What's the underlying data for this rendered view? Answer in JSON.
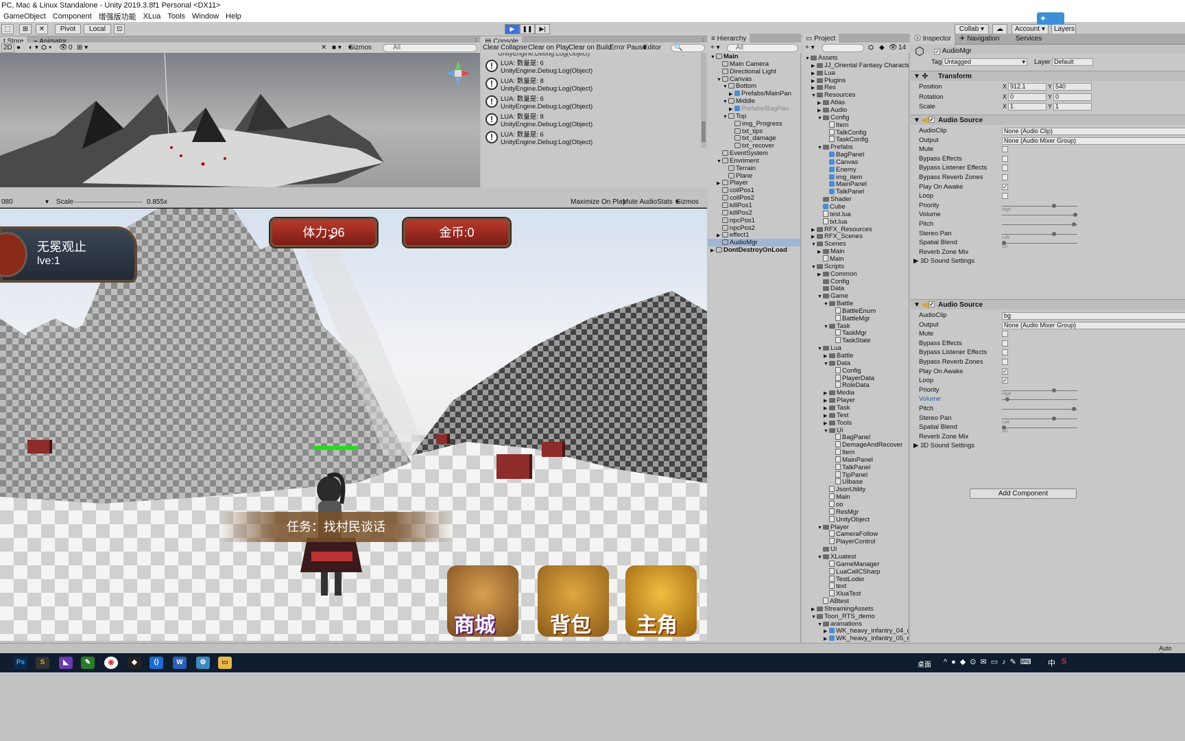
{
  "window": {
    "title": "PC, Mac & Linux Standalone - Unity 2019.3.8f1 Personal <DX11>"
  },
  "menu": [
    "GameObject",
    "Component",
    "增强版功能",
    "XLua",
    "Tools",
    "Window",
    "Help"
  ],
  "toolbar": {
    "pivot": "Pivot",
    "local": "Local",
    "collab": "Collab",
    "account": "Account",
    "layers": "Layers"
  },
  "scene": {
    "tabs": [
      "t Store",
      "Animator"
    ],
    "mode": "2D",
    "layer_count": "0",
    "gizmos": "Gizmos",
    "search": "All"
  },
  "console": {
    "tab": "Console",
    "buttons": [
      "Clear",
      "Collapse",
      "Clear on Play",
      "Clear on Build",
      "Error Pause",
      "Editor"
    ],
    "entries": [
      {
        "line1": "LUA: 数量是:  6",
        "line2": "UnityEngine.Debug:Log(Object)"
      },
      {
        "line1": "LUA: 数量是:  8",
        "line2": "UnityEngine.Debug:Log(Object)"
      },
      {
        "line1": "LUA: 数量是:  6",
        "line2": "UnityEngine.Debug:Log(Object)"
      },
      {
        "line1": "LUA: 数量是:  8",
        "line2": "UnityEngine.Debug:Log(Object)"
      },
      {
        "line1": "LUA: 数量是:  6",
        "line2": "UnityEngine.Debug:Log(Object)"
      }
    ]
  },
  "game": {
    "resolution": "080",
    "scale_label": "Scale",
    "scale_value": "0.855x",
    "buttons": [
      "Maximize On Play",
      "Mute Audio",
      "Stats",
      "Gizmos"
    ],
    "hud": {
      "player_name": "无冕观止",
      "level": "lve:1",
      "stamina": "体力:96",
      "gold": "金币:0",
      "task": "任务：找村民谈话",
      "shop": "商城",
      "bag": "背包",
      "hero": "主角"
    }
  },
  "hierarchy": {
    "tab": "Hierarchy",
    "search": "All",
    "items": [
      {
        "label": "Main",
        "depth": 0,
        "arrow": "▼",
        "type": "scene"
      },
      {
        "label": "Main Camera",
        "depth": 1,
        "arrow": "",
        "type": "go"
      },
      {
        "label": "Directional Light",
        "depth": 1,
        "arrow": "",
        "type": "go"
      },
      {
        "label": "Canvas",
        "depth": 1,
        "arrow": "▼",
        "type": "go"
      },
      {
        "label": "Bottom",
        "depth": 2,
        "arrow": "▼",
        "type": "go"
      },
      {
        "label": "Prefabs/MainPan",
        "depth": 3,
        "arrow": "▶",
        "type": "pref"
      },
      {
        "label": "Middle",
        "depth": 2,
        "arrow": "▼",
        "type": "go"
      },
      {
        "label": "Prefabs/BagPan",
        "depth": 3,
        "arrow": "▶",
        "type": "pref"
      },
      {
        "label": "Top",
        "depth": 2,
        "arrow": "▼",
        "type": "go"
      },
      {
        "label": "img_Progress",
        "depth": 3,
        "arrow": "",
        "type": "go"
      },
      {
        "label": "txt_tips",
        "depth": 3,
        "arrow": "",
        "type": "go"
      },
      {
        "label": "txt_damage",
        "depth": 3,
        "arrow": "",
        "type": "go"
      },
      {
        "label": "txt_recover",
        "depth": 3,
        "arrow": "",
        "type": "go"
      },
      {
        "label": "EventSystem",
        "depth": 1,
        "arrow": "",
        "type": "go"
      },
      {
        "label": "Envriment",
        "depth": 1,
        "arrow": "▼",
        "type": "go"
      },
      {
        "label": "Terrain",
        "depth": 2,
        "arrow": "",
        "type": "go"
      },
      {
        "label": "Plane",
        "depth": 2,
        "arrow": "",
        "type": "go"
      },
      {
        "label": "Player",
        "depth": 1,
        "arrow": "▶",
        "type": "go"
      },
      {
        "label": "collPos1",
        "depth": 1,
        "arrow": "",
        "type": "go"
      },
      {
        "label": "collPos2",
        "depth": 1,
        "arrow": "",
        "type": "go"
      },
      {
        "label": "killPos1",
        "depth": 1,
        "arrow": "",
        "type": "go"
      },
      {
        "label": "killPos2",
        "depth": 1,
        "arrow": "",
        "type": "go"
      },
      {
        "label": "npcPos1",
        "depth": 1,
        "arrow": "",
        "type": "go"
      },
      {
        "label": "npcPos2",
        "depth": 1,
        "arrow": "",
        "type": "go"
      },
      {
        "label": "effect1",
        "depth": 1,
        "arrow": "▶",
        "type": "go"
      },
      {
        "label": "AudioMgr",
        "depth": 1,
        "arrow": "",
        "type": "go"
      },
      {
        "label": "DontDestroyOnLoad",
        "depth": 0,
        "arrow": "▶",
        "type": "scene"
      }
    ]
  },
  "project": {
    "tab": "Project",
    "count": "14",
    "items": [
      {
        "label": "Assets",
        "depth": 0,
        "arrow": "▼",
        "type": "folder"
      },
      {
        "label": "JJ_Oriental Fantasy Character",
        "depth": 1,
        "arrow": "▶",
        "type": "folder"
      },
      {
        "label": "Lua",
        "depth": 1,
        "arrow": "▶",
        "type": "folder"
      },
      {
        "label": "Plugins",
        "depth": 1,
        "arrow": "▶",
        "type": "folder"
      },
      {
        "label": "Res",
        "depth": 1,
        "arrow": "▶",
        "type": "folder"
      },
      {
        "label": "Resources",
        "depth": 1,
        "arrow": "▼",
        "type": "folder"
      },
      {
        "label": "Atlas",
        "depth": 2,
        "arrow": "▶",
        "type": "folder"
      },
      {
        "label": "Audio",
        "depth": 2,
        "arrow": "▶",
        "type": "folder"
      },
      {
        "label": "Config",
        "depth": 2,
        "arrow": "▼",
        "type": "folder"
      },
      {
        "label": "Item",
        "depth": 3,
        "arrow": "",
        "type": "cs"
      },
      {
        "label": "TalkConfig",
        "depth": 3,
        "arrow": "",
        "type": "cs"
      },
      {
        "label": "TaskConfig",
        "depth": 3,
        "arrow": "",
        "type": "cs"
      },
      {
        "label": "Prefabs",
        "depth": 2,
        "arrow": "▼",
        "type": "folder"
      },
      {
        "label": "BagPanel",
        "depth": 3,
        "arrow": "",
        "type": "pref"
      },
      {
        "label": "Canvas",
        "depth": 3,
        "arrow": "",
        "type": "pref"
      },
      {
        "label": "Enemy",
        "depth": 3,
        "arrow": "",
        "type": "pref"
      },
      {
        "label": "img_item",
        "depth": 3,
        "arrow": "",
        "type": "pref"
      },
      {
        "label": "MainPanel",
        "depth": 3,
        "arrow": "",
        "type": "pref"
      },
      {
        "label": "TalkPanel",
        "depth": 3,
        "arrow": "",
        "type": "pref"
      },
      {
        "label": "Shader",
        "depth": 2,
        "arrow": "",
        "type": "folder"
      },
      {
        "label": "Cube",
        "depth": 2,
        "arrow": "",
        "type": "pref"
      },
      {
        "label": "test.lua",
        "depth": 2,
        "arrow": "",
        "type": "cs"
      },
      {
        "label": "txt.lua",
        "depth": 2,
        "arrow": "",
        "type": "cs"
      },
      {
        "label": "RFX_Resources",
        "depth": 1,
        "arrow": "▶",
        "type": "folder"
      },
      {
        "label": "RFX_Scenes",
        "depth": 1,
        "arrow": "▶",
        "type": "folder"
      },
      {
        "label": "Scenes",
        "depth": 1,
        "arrow": "▼",
        "type": "folder"
      },
      {
        "label": "Main",
        "depth": 2,
        "arrow": "▶",
        "type": "folder"
      },
      {
        "label": "Main",
        "depth": 2,
        "arrow": "",
        "type": "cs"
      },
      {
        "label": "Scripts",
        "depth": 1,
        "arrow": "▼",
        "type": "folder"
      },
      {
        "label": "Common",
        "depth": 2,
        "arrow": "▶",
        "type": "folder"
      },
      {
        "label": "Config",
        "depth": 2,
        "arrow": "",
        "type": "folder"
      },
      {
        "label": "Data",
        "depth": 2,
        "arrow": "",
        "type": "folder"
      },
      {
        "label": "Game",
        "depth": 2,
        "arrow": "▼",
        "type": "folder"
      },
      {
        "label": "Battle",
        "depth": 3,
        "arrow": "▼",
        "type": "folder"
      },
      {
        "label": "BattleEnum",
        "depth": 4,
        "arrow": "",
        "type": "cs"
      },
      {
        "label": "BattleMgr",
        "depth": 4,
        "arrow": "",
        "type": "cs"
      },
      {
        "label": "Task",
        "depth": 3,
        "arrow": "▼",
        "type": "folder"
      },
      {
        "label": "TaskMgr",
        "depth": 4,
        "arrow": "",
        "type": "cs"
      },
      {
        "label": "TaskState",
        "depth": 4,
        "arrow": "",
        "type": "cs"
      },
      {
        "label": "Lua",
        "depth": 2,
        "arrow": "▼",
        "type": "folder"
      },
      {
        "label": "Battle",
        "depth": 3,
        "arrow": "▶",
        "type": "folder"
      },
      {
        "label": "Data",
        "depth": 3,
        "arrow": "▼",
        "type": "folder"
      },
      {
        "label": "Config",
        "depth": 4,
        "arrow": "",
        "type": "cs"
      },
      {
        "label": "PlayerData",
        "depth": 4,
        "arrow": "",
        "type": "cs"
      },
      {
        "label": "RoleData",
        "depth": 4,
        "arrow": "",
        "type": "cs"
      },
      {
        "label": "Media",
        "depth": 3,
        "arrow": "▶",
        "type": "folder"
      },
      {
        "label": "Player",
        "depth": 3,
        "arrow": "▶",
        "type": "folder"
      },
      {
        "label": "Task",
        "depth": 3,
        "arrow": "▶",
        "type": "folder"
      },
      {
        "label": "Test",
        "depth": 3,
        "arrow": "▶",
        "type": "folder"
      },
      {
        "label": "Tools",
        "depth": 3,
        "arrow": "▶",
        "type": "folder"
      },
      {
        "label": "UI",
        "depth": 3,
        "arrow": "▼",
        "type": "folder"
      },
      {
        "label": "BagPanel",
        "depth": 4,
        "arrow": "",
        "type": "cs"
      },
      {
        "label": "DemageAndRecover",
        "depth": 4,
        "arrow": "",
        "type": "cs"
      },
      {
        "label": "Item",
        "depth": 4,
        "arrow": "",
        "type": "cs"
      },
      {
        "label": "MainPanel",
        "depth": 4,
        "arrow": "",
        "type": "cs"
      },
      {
        "label": "TalkPanel",
        "depth": 4,
        "arrow": "",
        "type": "cs"
      },
      {
        "label": "TipPanel",
        "depth": 4,
        "arrow": "",
        "type": "cs"
      },
      {
        "label": "UIbase",
        "depth": 4,
        "arrow": "",
        "type": "cs"
      },
      {
        "label": "JsonUtility",
        "depth": 3,
        "arrow": "",
        "type": "cs"
      },
      {
        "label": "Main",
        "depth": 3,
        "arrow": "",
        "type": "cs"
      },
      {
        "label": "oo",
        "depth": 3,
        "arrow": "",
        "type": "cs"
      },
      {
        "label": "ResMgr",
        "depth": 3,
        "arrow": "",
        "type": "cs"
      },
      {
        "label": "UnityObject",
        "depth": 3,
        "arrow": "",
        "type": "cs"
      },
      {
        "label": "Player",
        "depth": 2,
        "arrow": "▼",
        "type": "folder"
      },
      {
        "label": "CameraFollow",
        "depth": 3,
        "arrow": "",
        "type": "cs"
      },
      {
        "label": "PlayerControl",
        "depth": 3,
        "arrow": "",
        "type": "cs"
      },
      {
        "label": "UI",
        "depth": 2,
        "arrow": "",
        "type": "folder"
      },
      {
        "label": "XLuatest",
        "depth": 2,
        "arrow": "▼",
        "type": "folder"
      },
      {
        "label": "GameManager",
        "depth": 3,
        "arrow": "",
        "type": "cs"
      },
      {
        "label": "LuaCallCSharp",
        "depth": 3,
        "arrow": "",
        "type": "cs"
      },
      {
        "label": "TestLoder",
        "depth": 3,
        "arrow": "",
        "type": "cs"
      },
      {
        "label": "text",
        "depth": 3,
        "arrow": "",
        "type": "cs"
      },
      {
        "label": "XluaTest",
        "depth": 3,
        "arrow": "",
        "type": "cs"
      },
      {
        "label": "ABtest",
        "depth": 2,
        "arrow": "",
        "type": "cs"
      },
      {
        "label": "StreamingAssets",
        "depth": 1,
        "arrow": "▶",
        "type": "folder"
      },
      {
        "label": "Toon_RTS_demo",
        "depth": 1,
        "arrow": "▼",
        "type": "folder"
      },
      {
        "label": "animations",
        "depth": 2,
        "arrow": "▼",
        "type": "folder"
      },
      {
        "label": "WK_heavy_infantry_04_c",
        "depth": 3,
        "arrow": "▶",
        "type": "pref"
      },
      {
        "label": "WK_heavy_infantry_05_c",
        "depth": 3,
        "arrow": "▶",
        "type": "pref"
      }
    ]
  },
  "inspector": {
    "tabs": [
      "Inspector",
      "Navigation",
      "Services"
    ],
    "object_name": "AudioMgr",
    "tag_label": "Tag",
    "tag_value": "Untagged",
    "layer_label": "Layer",
    "layer_value": "Default",
    "transform": {
      "header": "Transform",
      "position_label": "Position",
      "position_x": "912.1",
      "position_y": "540",
      "rotation_label": "Rotation",
      "rotation_x": "0",
      "rotation_y": "0",
      "scale_label": "Scale",
      "scale_x": "1",
      "scale_y": "1"
    },
    "audio1": {
      "header": "Audio Source",
      "rows": [
        {
          "label": "AudioClip",
          "kind": "field",
          "value": "None (Audio Clip)"
        },
        {
          "label": "Output",
          "kind": "field",
          "value": "None (Audio Mixer Group)"
        },
        {
          "label": "Mute",
          "kind": "check",
          "value": ""
        },
        {
          "label": "Bypass Effects",
          "kind": "check",
          "value": ""
        },
        {
          "label": "Bypass Listener Effects",
          "kind": "check",
          "value": ""
        },
        {
          "label": "Bypass Reverb Zones",
          "kind": "check",
          "value": ""
        },
        {
          "label": "Play On Awake",
          "kind": "check",
          "value": "✓"
        },
        {
          "label": "Loop",
          "kind": "check",
          "value": ""
        },
        {
          "label": "Priority",
          "kind": "slider",
          "value": "",
          "pos": 0.7,
          "hint": "High"
        },
        {
          "label": "Volume",
          "kind": "slider",
          "value": "",
          "pos": 1.0,
          "hint": ""
        },
        {
          "label": "Pitch",
          "kind": "slider",
          "value": "",
          "pos": 0.98,
          "hint": ""
        },
        {
          "label": "Stereo Pan",
          "kind": "slider",
          "value": "",
          "pos": 0.7,
          "hint": "Left"
        },
        {
          "label": "Spatial Blend",
          "kind": "slider",
          "value": "",
          "pos": 0.0,
          "hint": "2D"
        },
        {
          "label": "Reverb Zone Mix",
          "kind": "none",
          "value": ""
        },
        {
          "label": "3D Sound Settings",
          "kind": "fold",
          "value": ""
        }
      ]
    },
    "audio2": {
      "header": "Audio Source",
      "rows": [
        {
          "label": "AudioClip",
          "kind": "field",
          "value": "bg"
        },
        {
          "label": "Output",
          "kind": "field",
          "value": "None (Audio Mixer Group)"
        },
        {
          "label": "Mute",
          "kind": "check",
          "value": ""
        },
        {
          "label": "Bypass Effects",
          "kind": "check",
          "value": ""
        },
        {
          "label": "Bypass Listener Effects",
          "kind": "check",
          "value": ""
        },
        {
          "label": "Bypass Reverb Zones",
          "kind": "check",
          "value": ""
        },
        {
          "label": "Play On Awake",
          "kind": "check",
          "value": "✓"
        },
        {
          "label": "Loop",
          "kind": "check",
          "value": "✓"
        },
        {
          "label": "Priority",
          "kind": "slider",
          "value": "",
          "pos": 0.7,
          "hint": "High"
        },
        {
          "label": "Volume",
          "kind": "slider",
          "value": "",
          "pos": 0.05,
          "hint": ""
        },
        {
          "label": "Pitch",
          "kind": "slider",
          "value": "",
          "pos": 0.98,
          "hint": ""
        },
        {
          "label": "Stereo Pan",
          "kind": "slider",
          "value": "",
          "pos": 0.7,
          "hint": "Left"
        },
        {
          "label": "Spatial Blend",
          "kind": "slider",
          "value": "",
          "pos": 0.0,
          "hint": "2D"
        },
        {
          "label": "Reverb Zone Mix",
          "kind": "none",
          "value": ""
        },
        {
          "label": "3D Sound Settings",
          "kind": "fold",
          "value": ""
        }
      ]
    },
    "add_component": "Add Component"
  },
  "statusbar": {
    "right": "Auto Gen"
  },
  "taskbar": {
    "apps": [
      "Ps",
      "S",
      "VS",
      "N",
      "Chrome",
      "Unity",
      "VS Code",
      "W",
      "Tool",
      "Folder"
    ],
    "desktop": "桌面",
    "ime": "中"
  },
  "colors": {
    "accent": "#3c74d6",
    "hud_red": "#a12a20",
    "health_bar": "#22dd22"
  }
}
